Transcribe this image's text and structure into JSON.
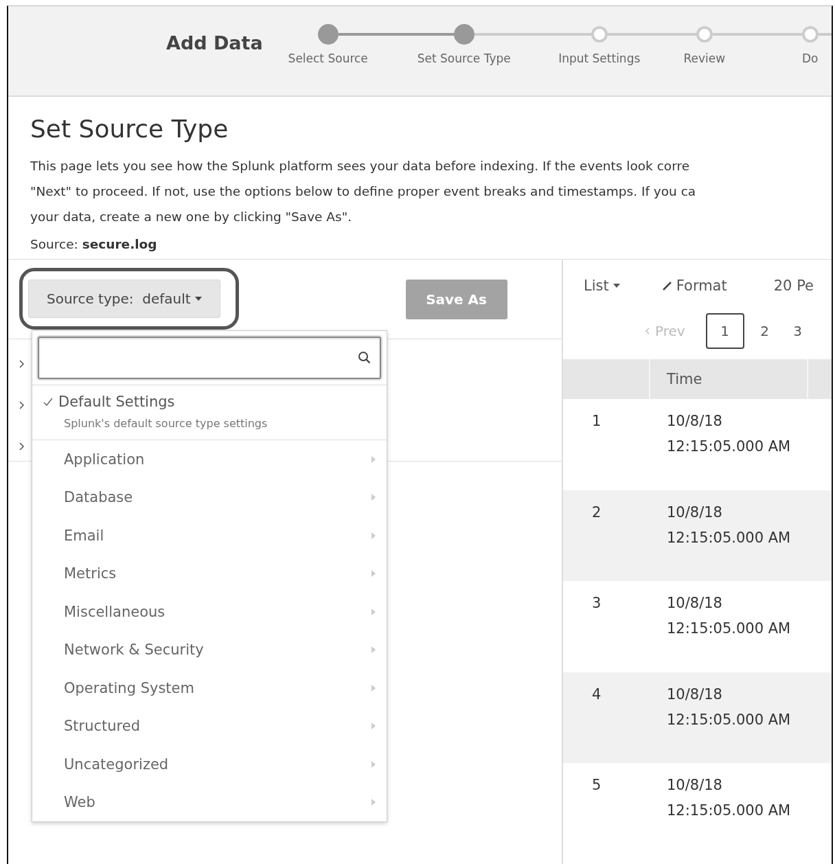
{
  "header": {
    "title": "Add Data",
    "steps": [
      {
        "label": "Select Source",
        "done": true
      },
      {
        "label": "Set Source Type",
        "done": true
      },
      {
        "label": "Input Settings",
        "done": false
      },
      {
        "label": "Review",
        "done": false
      },
      {
        "label": "Do",
        "done": false
      }
    ]
  },
  "page": {
    "title": "Set Source Type",
    "intro": "This page lets you see how the Splunk platform sees your data before indexing. If the events look corre\n\"Next\" to proceed. If not, use the options below to define proper event breaks and timestamps. If you ca\nyour data, create a new one by clicking \"Save As\".",
    "source_label": "Source:",
    "source_value": "secure.log"
  },
  "left_panel": {
    "sourcetype_button": "Source type:  default",
    "save_button": "Save As",
    "tree_rows": [
      {
        "expanded": false
      },
      {
        "expanded": false
      },
      {
        "expanded": false
      }
    ]
  },
  "dropdown": {
    "search": {
      "focused": true
    },
    "default_item": {
      "label": "Default Settings",
      "description": "Splunk's default source type settings",
      "checked": true
    },
    "categories": [
      "Application",
      "Database",
      "Email",
      "Metrics",
      "Miscellaneous",
      "Network & Security",
      "Operating System",
      "Structured",
      "Uncategorized",
      "Web"
    ]
  },
  "right_panel": {
    "view_menu": "List",
    "format_button": "Format",
    "per_page": "20 Pe",
    "prev": "Prev",
    "pages": [
      {
        "label": "1",
        "selected": true
      },
      {
        "label": "2",
        "selected": false
      },
      {
        "label": "3",
        "selected": false
      }
    ],
    "table": {
      "columns": [
        "",
        "Time"
      ],
      "rows": [
        {
          "index": "1",
          "date": "10/8/18",
          "time": "12:15:05.000 AM"
        },
        {
          "index": "2",
          "date": "10/8/18",
          "time": "12:15:05.000 AM"
        },
        {
          "index": "3",
          "date": "10/8/18",
          "time": "12:15:05.000 AM"
        },
        {
          "index": "4",
          "date": "10/8/18",
          "time": "12:15:05.000 AM"
        },
        {
          "index": "5",
          "date": "10/8/18",
          "time": "12:15:05.000 AM"
        }
      ]
    }
  }
}
